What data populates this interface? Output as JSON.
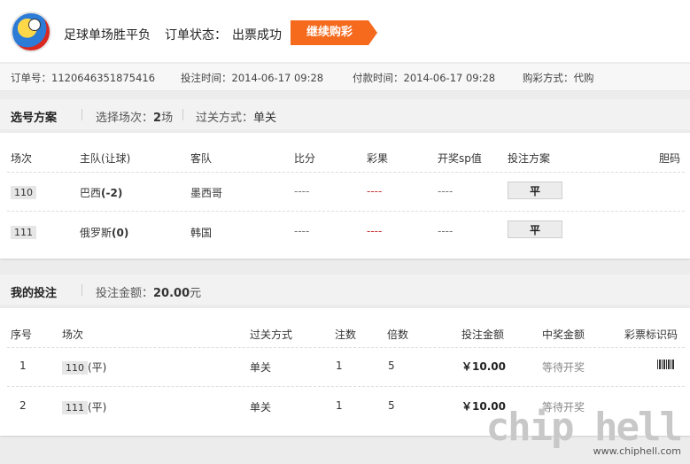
{
  "header": {
    "title": "足球单场胜平负",
    "status_label": "订单状态：",
    "status_value": "出票成功",
    "continue_label": "继续购彩"
  },
  "info": {
    "order_no": "订单号：1120646351875416",
    "bet_time": "投注时间：2014-06-17 09:28",
    "pay_time": "付款时间：2014-06-17 09:28",
    "buy_type": "购彩方式：代购"
  },
  "selection": {
    "title": "选号方案",
    "count_label": "选择场次：",
    "count_value": "2",
    "count_unit": "场",
    "pass_label": "过关方式：",
    "pass_value": "单关",
    "columns": [
      "场次",
      "主队(让球)",
      "客队",
      "比分",
      "彩果",
      "开奖sp值",
      "投注方案",
      "胆码"
    ],
    "rows": [
      {
        "match": "110",
        "home": "巴西",
        "handicap": "(-2)",
        "away": "墨西哥",
        "score": "----",
        "result": "----",
        "sp": "----",
        "pick": "平"
      },
      {
        "match": "111",
        "home": "俄罗斯",
        "handicap": "(0)",
        "away": "韩国",
        "score": "----",
        "result": "----",
        "sp": "----",
        "pick": "平"
      }
    ]
  },
  "bets": {
    "title": "我的投注",
    "amount_label": "投注金额：",
    "amount_value": "20.00",
    "amount_unit": "元",
    "columns": [
      "序号",
      "场次",
      "过关方式",
      "注数",
      "倍数",
      "投注金额",
      "中奖金额",
      "彩票标识码"
    ],
    "rows": [
      {
        "no": "1",
        "match": "110",
        "match_pick": "(平)",
        "pass": "单关",
        "count": "1",
        "multiple": "5",
        "amount": "￥10.00",
        "prize": "等待开奖"
      },
      {
        "no": "2",
        "match": "111",
        "match_pick": "(平)",
        "pass": "单关",
        "count": "1",
        "multiple": "5",
        "amount": "￥10.00",
        "prize": "等待开奖"
      }
    ]
  },
  "watermark": {
    "text": "chip hell",
    "url": "www.chiphell.com"
  },
  "colors": {
    "accent": "#f56a1d",
    "result_red": "#cc3333"
  }
}
